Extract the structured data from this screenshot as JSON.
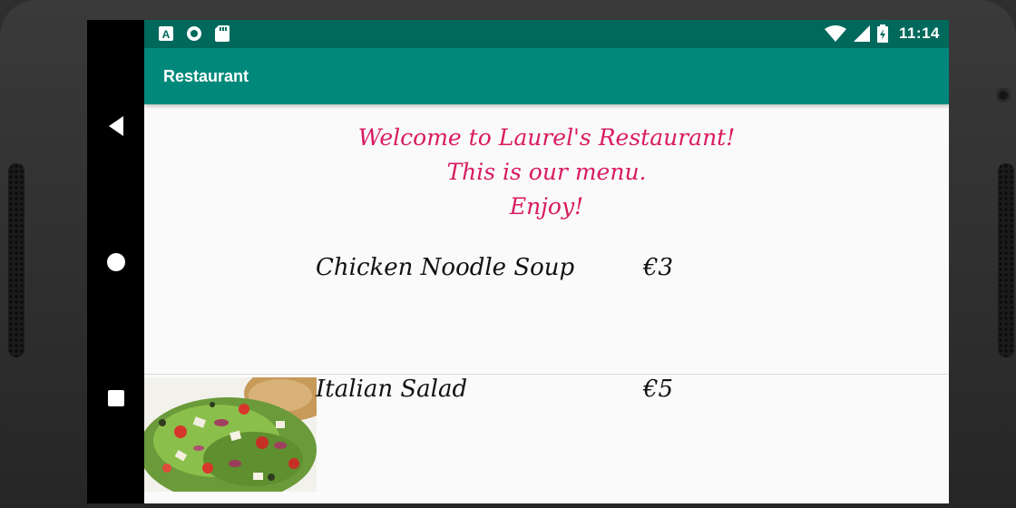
{
  "status_bar": {
    "icons": [
      "a-notification-icon",
      "circle-notification-icon",
      "sd-card-icon",
      "wifi-icon",
      "cell-signal-icon",
      "battery-charging-icon"
    ],
    "time": "11:14"
  },
  "app_bar": {
    "title": "Restaurant"
  },
  "welcome": {
    "line1": "Welcome to Laurel's Restaurant!",
    "line2": "This is our menu.",
    "line3": "Enjoy!"
  },
  "menu": {
    "items": [
      {
        "name": "Chicken Noodle Soup",
        "price": "€3",
        "image": "none"
      },
      {
        "name": "Italian Salad",
        "price": "€5",
        "image": "salad-photo"
      }
    ]
  },
  "colors": {
    "status_bar": "#00695c",
    "app_bar": "#00897b",
    "welcome_text": "#d81b60"
  }
}
